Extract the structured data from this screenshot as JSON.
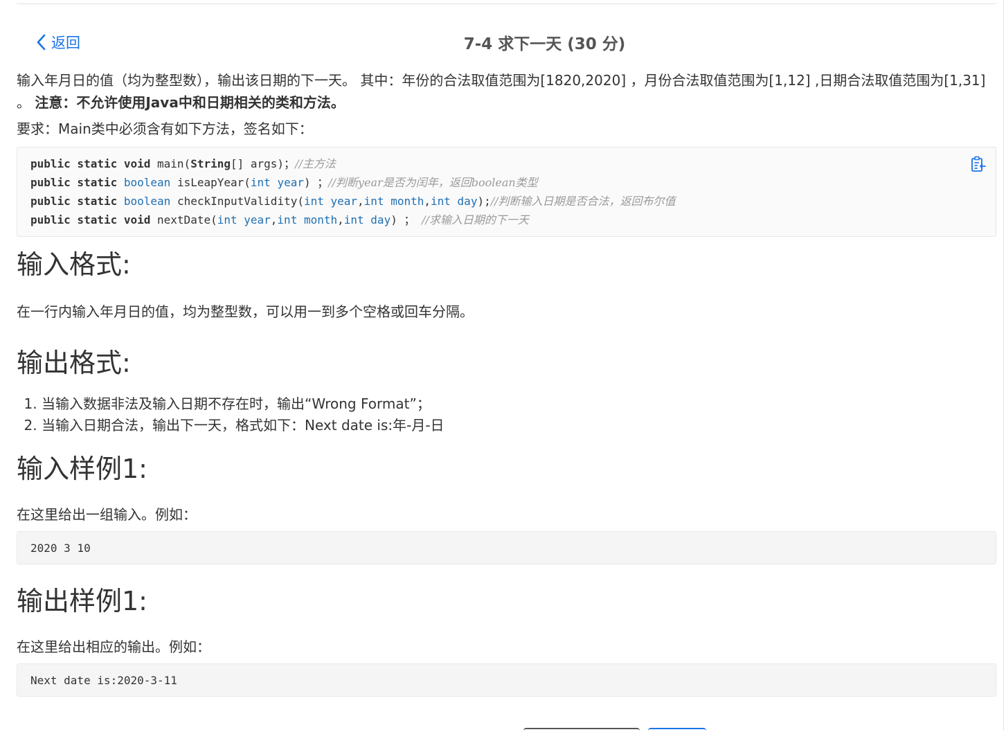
{
  "header": {
    "back_label": "返回",
    "title": "7-4 求下一天 (30 分)"
  },
  "problem": {
    "desc_text": "输入年月日的值（均为整型数），输出该日期的下一天。 其中：年份的合法取值范围为[1820,2020] ，月份合法取值范围为[1,12] ,日期合法取值范围为[1,31] 。 ",
    "desc_note": "注意：不允许使用Java中和日期相关的类和方法。",
    "requirement": "要求：Main类中必须含有如下方法，签名如下：",
    "code": {
      "line1": {
        "kw": "public static void",
        "rest": " main(",
        "ty": "String",
        "rest2": "[] args)；",
        "comment": "//主方法"
      },
      "line2": {
        "kw": "public static",
        "ty": "boolean",
        "rest": " isLeapYear(",
        "param": "int year",
        "rest2": ") ；",
        "comment": "//判断year是否为闰年，返回boolean类型"
      },
      "line3": {
        "kw": "public static",
        "ty": "boolean",
        "rest": " checkInputValidity(",
        "p1": "int year",
        "p2": "int month",
        "p3": "int day",
        "rest2": ");",
        "comment": "//判断输入日期是否合法，返回布尔值"
      },
      "line4": {
        "kw": "public static void",
        "rest": " nextDate(",
        "p1": "int year",
        "p2": "int month",
        "p3": "int day",
        "rest2": ") ；",
        "comment": "//求输入日期的下一天"
      }
    }
  },
  "input_format": {
    "heading": "输入格式:",
    "text": "在一行内输入年月日的值，均为整型数，可以用一到多个空格或回车分隔。"
  },
  "output_format": {
    "heading": "输出格式:",
    "items": [
      "当输入数据非法及输入日期不存在时，输出“Wrong Format”；",
      "当输入日期合法，输出下一天，格式如下：Next date is:年-月-日"
    ]
  },
  "input_sample": {
    "heading": "输入样例1:",
    "text": "在这里给出一组输入。例如：",
    "code": "2020 3 10"
  },
  "output_sample": {
    "heading": "输出样例1:",
    "text": "在这里给出相应的输出。例如：",
    "code": "Next date is:2020-3-11"
  },
  "icons": {
    "back": "chevron-left-icon",
    "copy": "clipboard-copy-icon"
  },
  "colors": {
    "accent": "#1a73e8",
    "type_keyword": "#1f6fb2",
    "comment": "#9a9a9a"
  }
}
